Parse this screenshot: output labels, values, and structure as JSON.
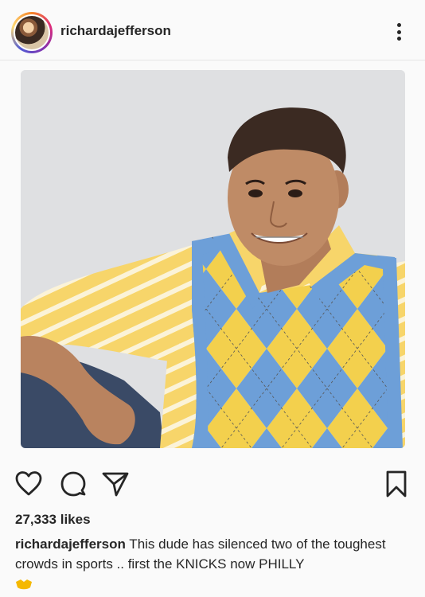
{
  "post": {
    "username": "richardajefferson",
    "likes": "27,333 likes",
    "caption_user": "richardajefferson",
    "caption_text": " This dude has silenced two of the toughest crowds in sports .. first the KNICKS now PHILLY",
    "caption_emoji_icon": "handshake-icon"
  },
  "icons": {
    "more": "more-vertical-icon",
    "like": "heart-icon",
    "comment": "comment-icon",
    "share": "paper-plane-icon",
    "save": "bookmark-icon"
  },
  "colors": {
    "text": "#262626",
    "background": "#fafafa",
    "emoji": "#f5b800"
  }
}
